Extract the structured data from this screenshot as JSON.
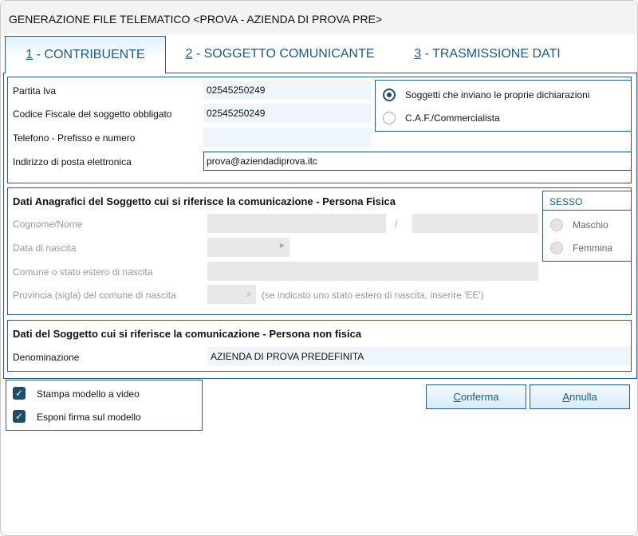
{
  "window": {
    "title": "GENERAZIONE FILE TELEMATICO <PROVA - AZIENDA DI PROVA PRE>"
  },
  "tabs": [
    {
      "key": "1",
      "label": " - CONTRIBUENTE"
    },
    {
      "key": "2",
      "label": " - SOGGETTO COMUNICANTE"
    },
    {
      "key": "3",
      "label": " - TRASMISSIONE DATI"
    }
  ],
  "contribuente": {
    "partita_iva_label": "Partita Iva",
    "partita_iva": "02545250249",
    "cf_label": "Codice Fiscale del soggetto obbligato",
    "cf": "02545250249",
    "telefono_label": "Telefono - Prefisso e numero",
    "telefono": "",
    "email_label": "Indirizzo di posta elettronica",
    "email": "prova@aziendadiprova.itc",
    "radio_options": [
      "Soggetti che inviano le proprie dichiarazioni",
      "C.A.F./Commercialista"
    ],
    "radio_selected": 0
  },
  "persona_fisica": {
    "heading": "Dati Anagrafici del Soggetto cui si riferisce la comunicazione - Persona Fisica",
    "cognome_nome_label": "Cognome/Nome",
    "separator": "/",
    "data_nascita_label": "Data di nascita",
    "comune_label": "Comune o stato estero di nascita",
    "provincia_label": "Provincia (sigla) del comune di nascita",
    "provincia_hint": "(se indicato uno stato estero di nascita, inserire 'EE')",
    "sesso_label": "SESSO",
    "sesso_options": [
      "Maschio",
      "Femmina"
    ]
  },
  "persona_non_fisica": {
    "heading": "Dati del Soggetto cui si riferisce la comunicazione - Persona non fisica",
    "denominazione_label": "Denominazione",
    "denominazione": "AZIENDA DI PROVA PREDEFINITA"
  },
  "options": [
    {
      "label": "Stampa modello a video",
      "checked": true
    },
    {
      "label": "Esponi firma sul modello",
      "checked": true
    }
  ],
  "buttons": {
    "conferma_key": "C",
    "conferma_rest": "onferma",
    "annulla_key": "A",
    "annulla_rest": "nnulla"
  }
}
